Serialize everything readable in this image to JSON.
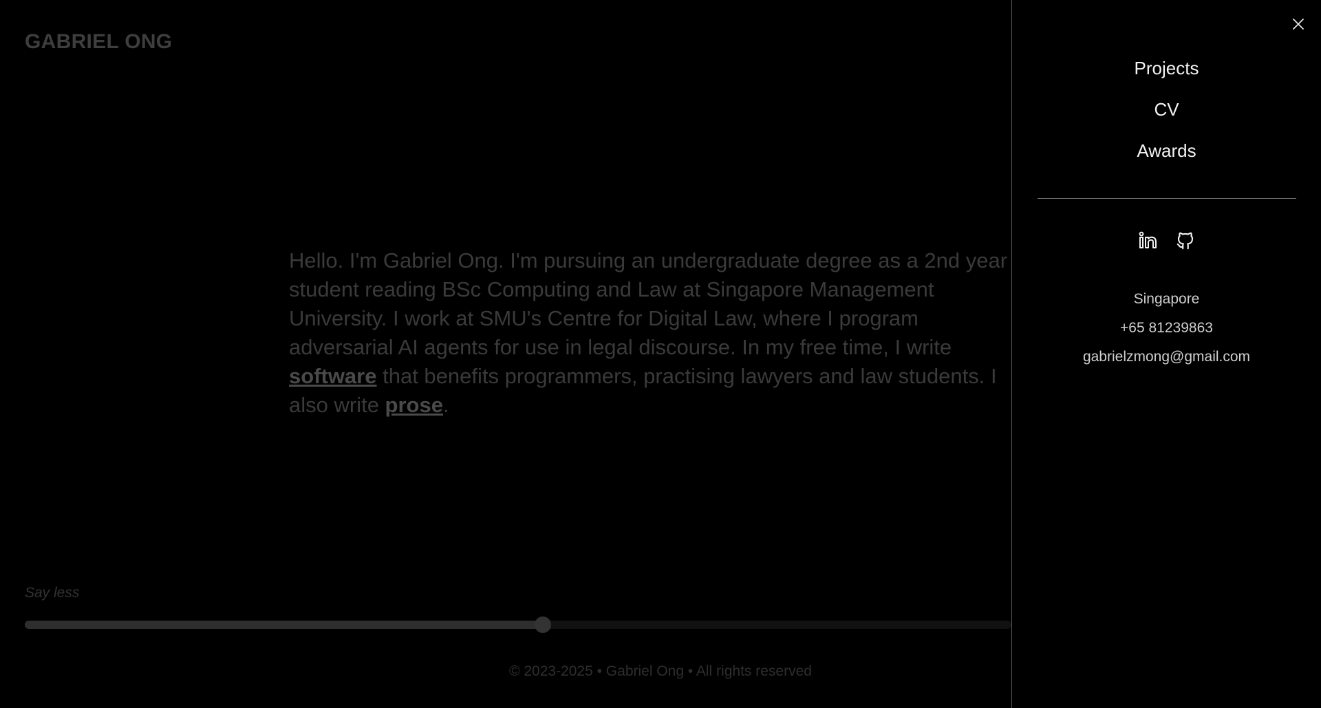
{
  "site": {
    "logo": "GABRIEL ONG"
  },
  "bio": {
    "text_1": "Hello. I'm Gabriel Ong. I'm pursuing an undergraduate degree as a 2nd year student reading BSc Computing and Law at Singapore Management University. I work at SMU's Centre for Digital Law, where I program adversarial AI agents for use in legal discourse. In my free time, I write ",
    "link_software": "software",
    "text_2": " that benefits programmers, practising lawyers and law students. I also write ",
    "link_prose": "prose",
    "text_3": "."
  },
  "verbosity": {
    "label": "Say less",
    "value_fraction": 0.525
  },
  "footer": {
    "text": "© 2023-2025 • Gabriel Ong • All rights reserved"
  },
  "menu": {
    "close_icon": "close-icon",
    "items": [
      {
        "label": "Projects"
      },
      {
        "label": "CV"
      },
      {
        "label": "Awards"
      }
    ],
    "socials": [
      {
        "icon": "linkedin-icon"
      },
      {
        "icon": "github-icon"
      }
    ],
    "contact": {
      "location": "Singapore",
      "phone": "+65 81239863",
      "email": "gabrielzmong@gmail.com"
    }
  },
  "colors": {
    "background": "#000000",
    "menu_text": "#f2f2f2",
    "dimmed_text": "#3a3a3a"
  }
}
